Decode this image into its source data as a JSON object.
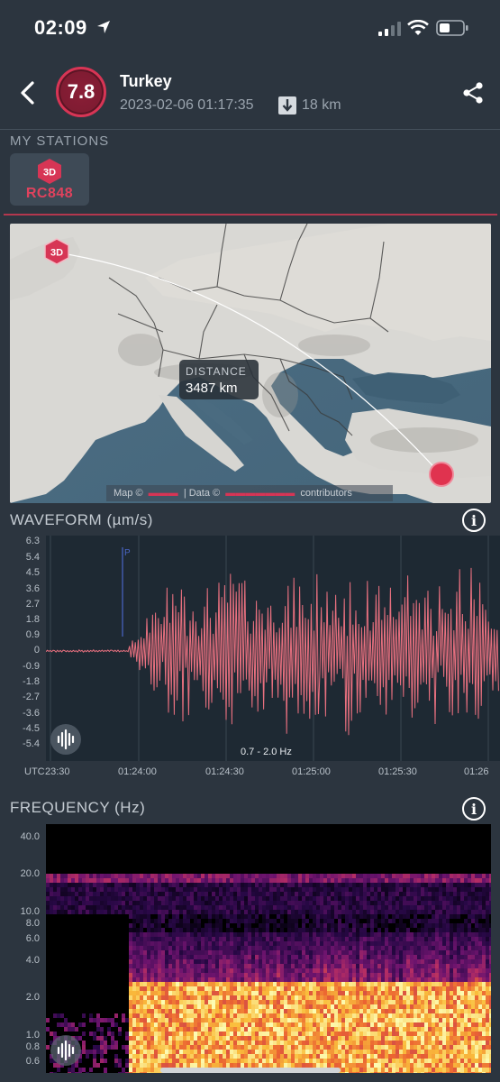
{
  "status_bar": {
    "time": "02:09"
  },
  "event": {
    "magnitude": "7.8",
    "title": "Turkey",
    "datetime": "2023-02-06 01:17:35",
    "depth": "18 km"
  },
  "my_stations": {
    "label": "MY STATIONS",
    "stations": [
      {
        "badge": "3D",
        "name": "RC848"
      }
    ]
  },
  "map": {
    "distance_label": "DISTANCE",
    "distance_value": "3487 km",
    "station_badge": "3D",
    "attribution_map": "Map ©",
    "attribution_data": "| Data ©",
    "attribution_contributors": "contributors"
  },
  "waveform": {
    "title": "WAVEFORM (µm/s)",
    "filter": "0.7 - 2.0 Hz",
    "tz_label": "UTC",
    "p_marker": "P",
    "y_ticks": [
      "6.3",
      "5.4",
      "4.5",
      "3.6",
      "2.7",
      "1.8",
      "0.9",
      "0",
      "-0.9",
      "-1.8",
      "-2.7",
      "-3.6",
      "-4.5",
      "-5.4"
    ],
    "x_ticks": [
      "23:30",
      "01:24:00",
      "01:24:30",
      "01:25:00",
      "01:25:30",
      "01:26"
    ]
  },
  "frequency": {
    "title": "FREQUENCY (Hz)",
    "y_ticks": [
      "40.0",
      "20.0",
      "10.0",
      "8.0",
      "6.0",
      "4.0",
      "2.0",
      "1.0",
      "0.8",
      "0.6"
    ]
  },
  "colors": {
    "accent": "#d73555",
    "background": "#2c353f",
    "waveform_line": "#e8707f",
    "panel": "#1e2933"
  }
}
